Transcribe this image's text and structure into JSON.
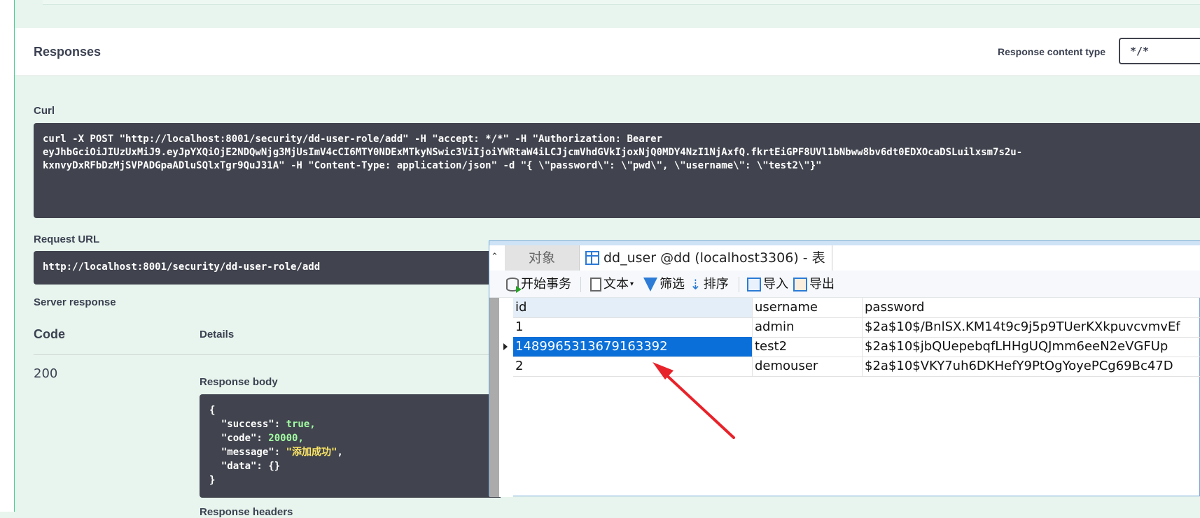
{
  "responses": {
    "title": "Responses",
    "content_type_label": "Response content type",
    "content_type_value": "*/*"
  },
  "curl": {
    "label": "Curl",
    "command": "curl -X POST \"http://localhost:8001/security/dd-user-role/add\" -H \"accept: */*\" -H \"Authorization: Bearer\neyJhbGciOiJIUzUxMiJ9.eyJpYXQiOjE2NDQwNjg3MjUsImV4cCI6MTY0NDExMTkyNSwic3ViIjoiYWRtaW4iLCJjcmVhdGVkIjoxNjQ0MDY4NzI1NjAxfQ.fkrtEiGPF8UVl1bNbww8bv6dt0EDXOcaDSLuilxsm7s2u-\nkxnvyDxRFbDzMjSVPADGpaADluSQlxTgr9QuJ31A\" -H \"Content-Type: application/json\" -d \"{ \\\"password\\\": \\\"pwd\\\", \\\"username\\\": \\\"test2\\\"}\""
  },
  "request_url": {
    "label": "Request URL",
    "value": "http://localhost:8001/security/dd-user-role/add"
  },
  "server_response": {
    "label": "Server response",
    "code_header": "Code",
    "details_header": "Details",
    "code": "200",
    "body_label": "Response body",
    "body_line1": "{",
    "body_success_key": "  \"success\": ",
    "body_success_val": "true,",
    "body_code_key": "  \"code\": ",
    "body_code_val": "20000,",
    "body_message_key": "  \"message\": ",
    "body_message_val": "\"添加成功\"",
    "body_message_tail": ",",
    "body_data_key": "  \"data\": ",
    "body_data_val": "{}",
    "body_line_end": "}",
    "headers_label": "Response headers"
  },
  "db_window": {
    "tab_objects": "对象",
    "tab_active": "dd_user @dd (localhost3306) - 表",
    "toolbar": {
      "begin_tx": "开始事务",
      "text": "文本",
      "filter": "筛选",
      "sort": "排序",
      "import": "导入",
      "export": "导出"
    },
    "columns": [
      "id",
      "username",
      "password"
    ],
    "rows": [
      {
        "id": "1",
        "username": "admin",
        "password": "$2a$10$/BnlSX.KM14t9c9j5p9TUerKXkpuvcvmvEf"
      },
      {
        "id": "1489965313679163392",
        "username": "test2",
        "password": "$2a$10$jbQUepebqfLHHgUQJmm6eeN2eVGFUp"
      },
      {
        "id": "2",
        "username": "demouser",
        "password": "$2a$10$VKY7uh6DKHefY9PtOgYoyePCg69Bc47D"
      }
    ],
    "selected_row": 1
  },
  "colors": {
    "accent_green": "#49cc90",
    "code_bg": "#41444e",
    "selection_blue": "#0a6fd8",
    "arrow_red": "#e8222a"
  }
}
